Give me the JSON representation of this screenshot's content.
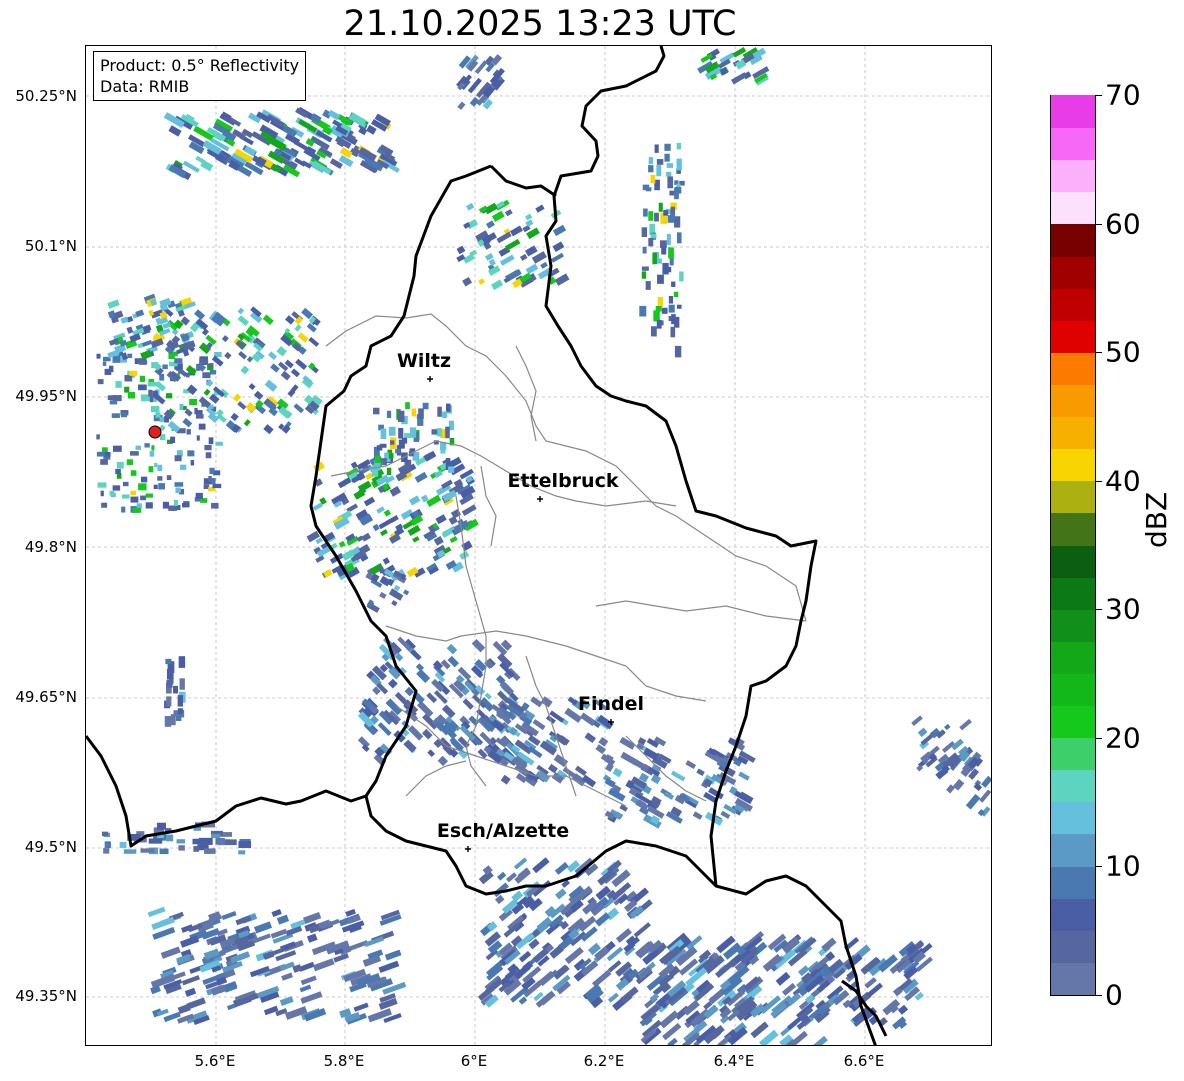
{
  "title": "21.10.2025 13:23 UTC",
  "info": {
    "product": "Product: 0.5° Reflectivity",
    "data_source": "Data: RMIB"
  },
  "colorbar": {
    "label": "dBZ",
    "ticks": [
      "0",
      "10",
      "20",
      "30",
      "40",
      "50",
      "60",
      "70"
    ],
    "colors": [
      "#6577a8",
      "#5667a0",
      "#4a5ea6",
      "#4a78b0",
      "#5a9ac4",
      "#64c0dc",
      "#5cd4c0",
      "#3ccf6a",
      "#14c81c",
      "#12b81a",
      "#12a818",
      "#10901a",
      "#0c7a14",
      "#0c5e10",
      "#447418",
      "#acb010",
      "#f8d400",
      "#f8b000",
      "#f89a00",
      "#fc7a00",
      "#e00000",
      "#c00000",
      "#a00000",
      "#780000",
      "#fce0fc",
      "#fcb0fc",
      "#f868f8",
      "#e83ce8"
    ]
  },
  "map": {
    "lat_ticks": [
      "50.25°N",
      "50.1°N",
      "49.95°N",
      "49.8°N",
      "49.65°N",
      "49.5°N",
      "49.35°N"
    ],
    "lon_ticks": [
      "5.6°E",
      "5.8°E",
      "6°E",
      "6.2°E",
      "6.4°E",
      "6.6°E"
    ],
    "cities": [
      {
        "name": "Wiltz"
      },
      {
        "name": "Ettelbruck"
      },
      {
        "name": "Findel"
      },
      {
        "name": "Esch/Alzette"
      }
    ],
    "radar_site_color": "#e02020"
  }
}
